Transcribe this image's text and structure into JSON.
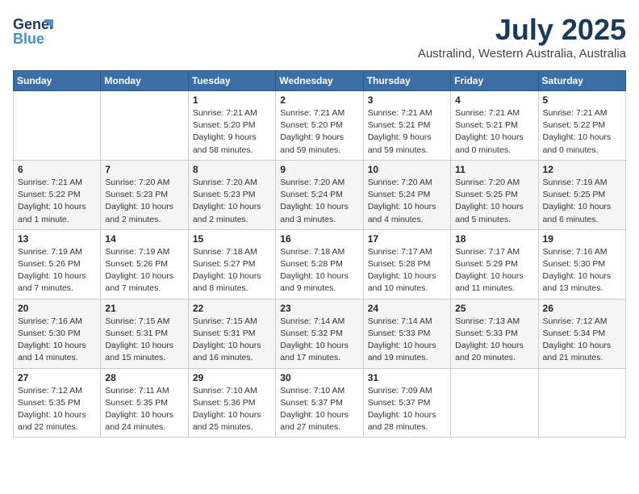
{
  "header": {
    "logo_general": "General",
    "logo_blue": "Blue",
    "month_year": "July 2025",
    "location": "Australind, Western Australia, Australia"
  },
  "weekdays": [
    "Sunday",
    "Monday",
    "Tuesday",
    "Wednesday",
    "Thursday",
    "Friday",
    "Saturday"
  ],
  "weeks": [
    [
      {
        "day": "",
        "info": ""
      },
      {
        "day": "",
        "info": ""
      },
      {
        "day": "1",
        "info": "Sunrise: 7:21 AM\nSunset: 5:20 PM\nDaylight: 9 hours\nand 58 minutes."
      },
      {
        "day": "2",
        "info": "Sunrise: 7:21 AM\nSunset: 5:20 PM\nDaylight: 9 hours\nand 59 minutes."
      },
      {
        "day": "3",
        "info": "Sunrise: 7:21 AM\nSunset: 5:21 PM\nDaylight: 9 hours\nand 59 minutes."
      },
      {
        "day": "4",
        "info": "Sunrise: 7:21 AM\nSunset: 5:21 PM\nDaylight: 10 hours\nand 0 minutes."
      },
      {
        "day": "5",
        "info": "Sunrise: 7:21 AM\nSunset: 5:22 PM\nDaylight: 10 hours\nand 0 minutes."
      }
    ],
    [
      {
        "day": "6",
        "info": "Sunrise: 7:21 AM\nSunset: 5:22 PM\nDaylight: 10 hours\nand 1 minute."
      },
      {
        "day": "7",
        "info": "Sunrise: 7:20 AM\nSunset: 5:23 PM\nDaylight: 10 hours\nand 2 minutes."
      },
      {
        "day": "8",
        "info": "Sunrise: 7:20 AM\nSunset: 5:23 PM\nDaylight: 10 hours\nand 2 minutes."
      },
      {
        "day": "9",
        "info": "Sunrise: 7:20 AM\nSunset: 5:24 PM\nDaylight: 10 hours\nand 3 minutes."
      },
      {
        "day": "10",
        "info": "Sunrise: 7:20 AM\nSunset: 5:24 PM\nDaylight: 10 hours\nand 4 minutes."
      },
      {
        "day": "11",
        "info": "Sunrise: 7:20 AM\nSunset: 5:25 PM\nDaylight: 10 hours\nand 5 minutes."
      },
      {
        "day": "12",
        "info": "Sunrise: 7:19 AM\nSunset: 5:25 PM\nDaylight: 10 hours\nand 6 minutes."
      }
    ],
    [
      {
        "day": "13",
        "info": "Sunrise: 7:19 AM\nSunset: 5:26 PM\nDaylight: 10 hours\nand 7 minutes."
      },
      {
        "day": "14",
        "info": "Sunrise: 7:19 AM\nSunset: 5:26 PM\nDaylight: 10 hours\nand 7 minutes."
      },
      {
        "day": "15",
        "info": "Sunrise: 7:18 AM\nSunset: 5:27 PM\nDaylight: 10 hours\nand 8 minutes."
      },
      {
        "day": "16",
        "info": "Sunrise: 7:18 AM\nSunset: 5:28 PM\nDaylight: 10 hours\nand 9 minutes."
      },
      {
        "day": "17",
        "info": "Sunrise: 7:17 AM\nSunset: 5:28 PM\nDaylight: 10 hours\nand 10 minutes."
      },
      {
        "day": "18",
        "info": "Sunrise: 7:17 AM\nSunset: 5:29 PM\nDaylight: 10 hours\nand 11 minutes."
      },
      {
        "day": "19",
        "info": "Sunrise: 7:16 AM\nSunset: 5:30 PM\nDaylight: 10 hours\nand 13 minutes."
      }
    ],
    [
      {
        "day": "20",
        "info": "Sunrise: 7:16 AM\nSunset: 5:30 PM\nDaylight: 10 hours\nand 14 minutes."
      },
      {
        "day": "21",
        "info": "Sunrise: 7:15 AM\nSunset: 5:31 PM\nDaylight: 10 hours\nand 15 minutes."
      },
      {
        "day": "22",
        "info": "Sunrise: 7:15 AM\nSunset: 5:31 PM\nDaylight: 10 hours\nand 16 minutes."
      },
      {
        "day": "23",
        "info": "Sunrise: 7:14 AM\nSunset: 5:32 PM\nDaylight: 10 hours\nand 17 minutes."
      },
      {
        "day": "24",
        "info": "Sunrise: 7:14 AM\nSunset: 5:33 PM\nDaylight: 10 hours\nand 19 minutes."
      },
      {
        "day": "25",
        "info": "Sunrise: 7:13 AM\nSunset: 5:33 PM\nDaylight: 10 hours\nand 20 minutes."
      },
      {
        "day": "26",
        "info": "Sunrise: 7:12 AM\nSunset: 5:34 PM\nDaylight: 10 hours\nand 21 minutes."
      }
    ],
    [
      {
        "day": "27",
        "info": "Sunrise: 7:12 AM\nSunset: 5:35 PM\nDaylight: 10 hours\nand 22 minutes."
      },
      {
        "day": "28",
        "info": "Sunrise: 7:11 AM\nSunset: 5:35 PM\nDaylight: 10 hours\nand 24 minutes."
      },
      {
        "day": "29",
        "info": "Sunrise: 7:10 AM\nSunset: 5:36 PM\nDaylight: 10 hours\nand 25 minutes."
      },
      {
        "day": "30",
        "info": "Sunrise: 7:10 AM\nSunset: 5:37 PM\nDaylight: 10 hours\nand 27 minutes."
      },
      {
        "day": "31",
        "info": "Sunrise: 7:09 AM\nSunset: 5:37 PM\nDaylight: 10 hours\nand 28 minutes."
      },
      {
        "day": "",
        "info": ""
      },
      {
        "day": "",
        "info": ""
      }
    ]
  ]
}
